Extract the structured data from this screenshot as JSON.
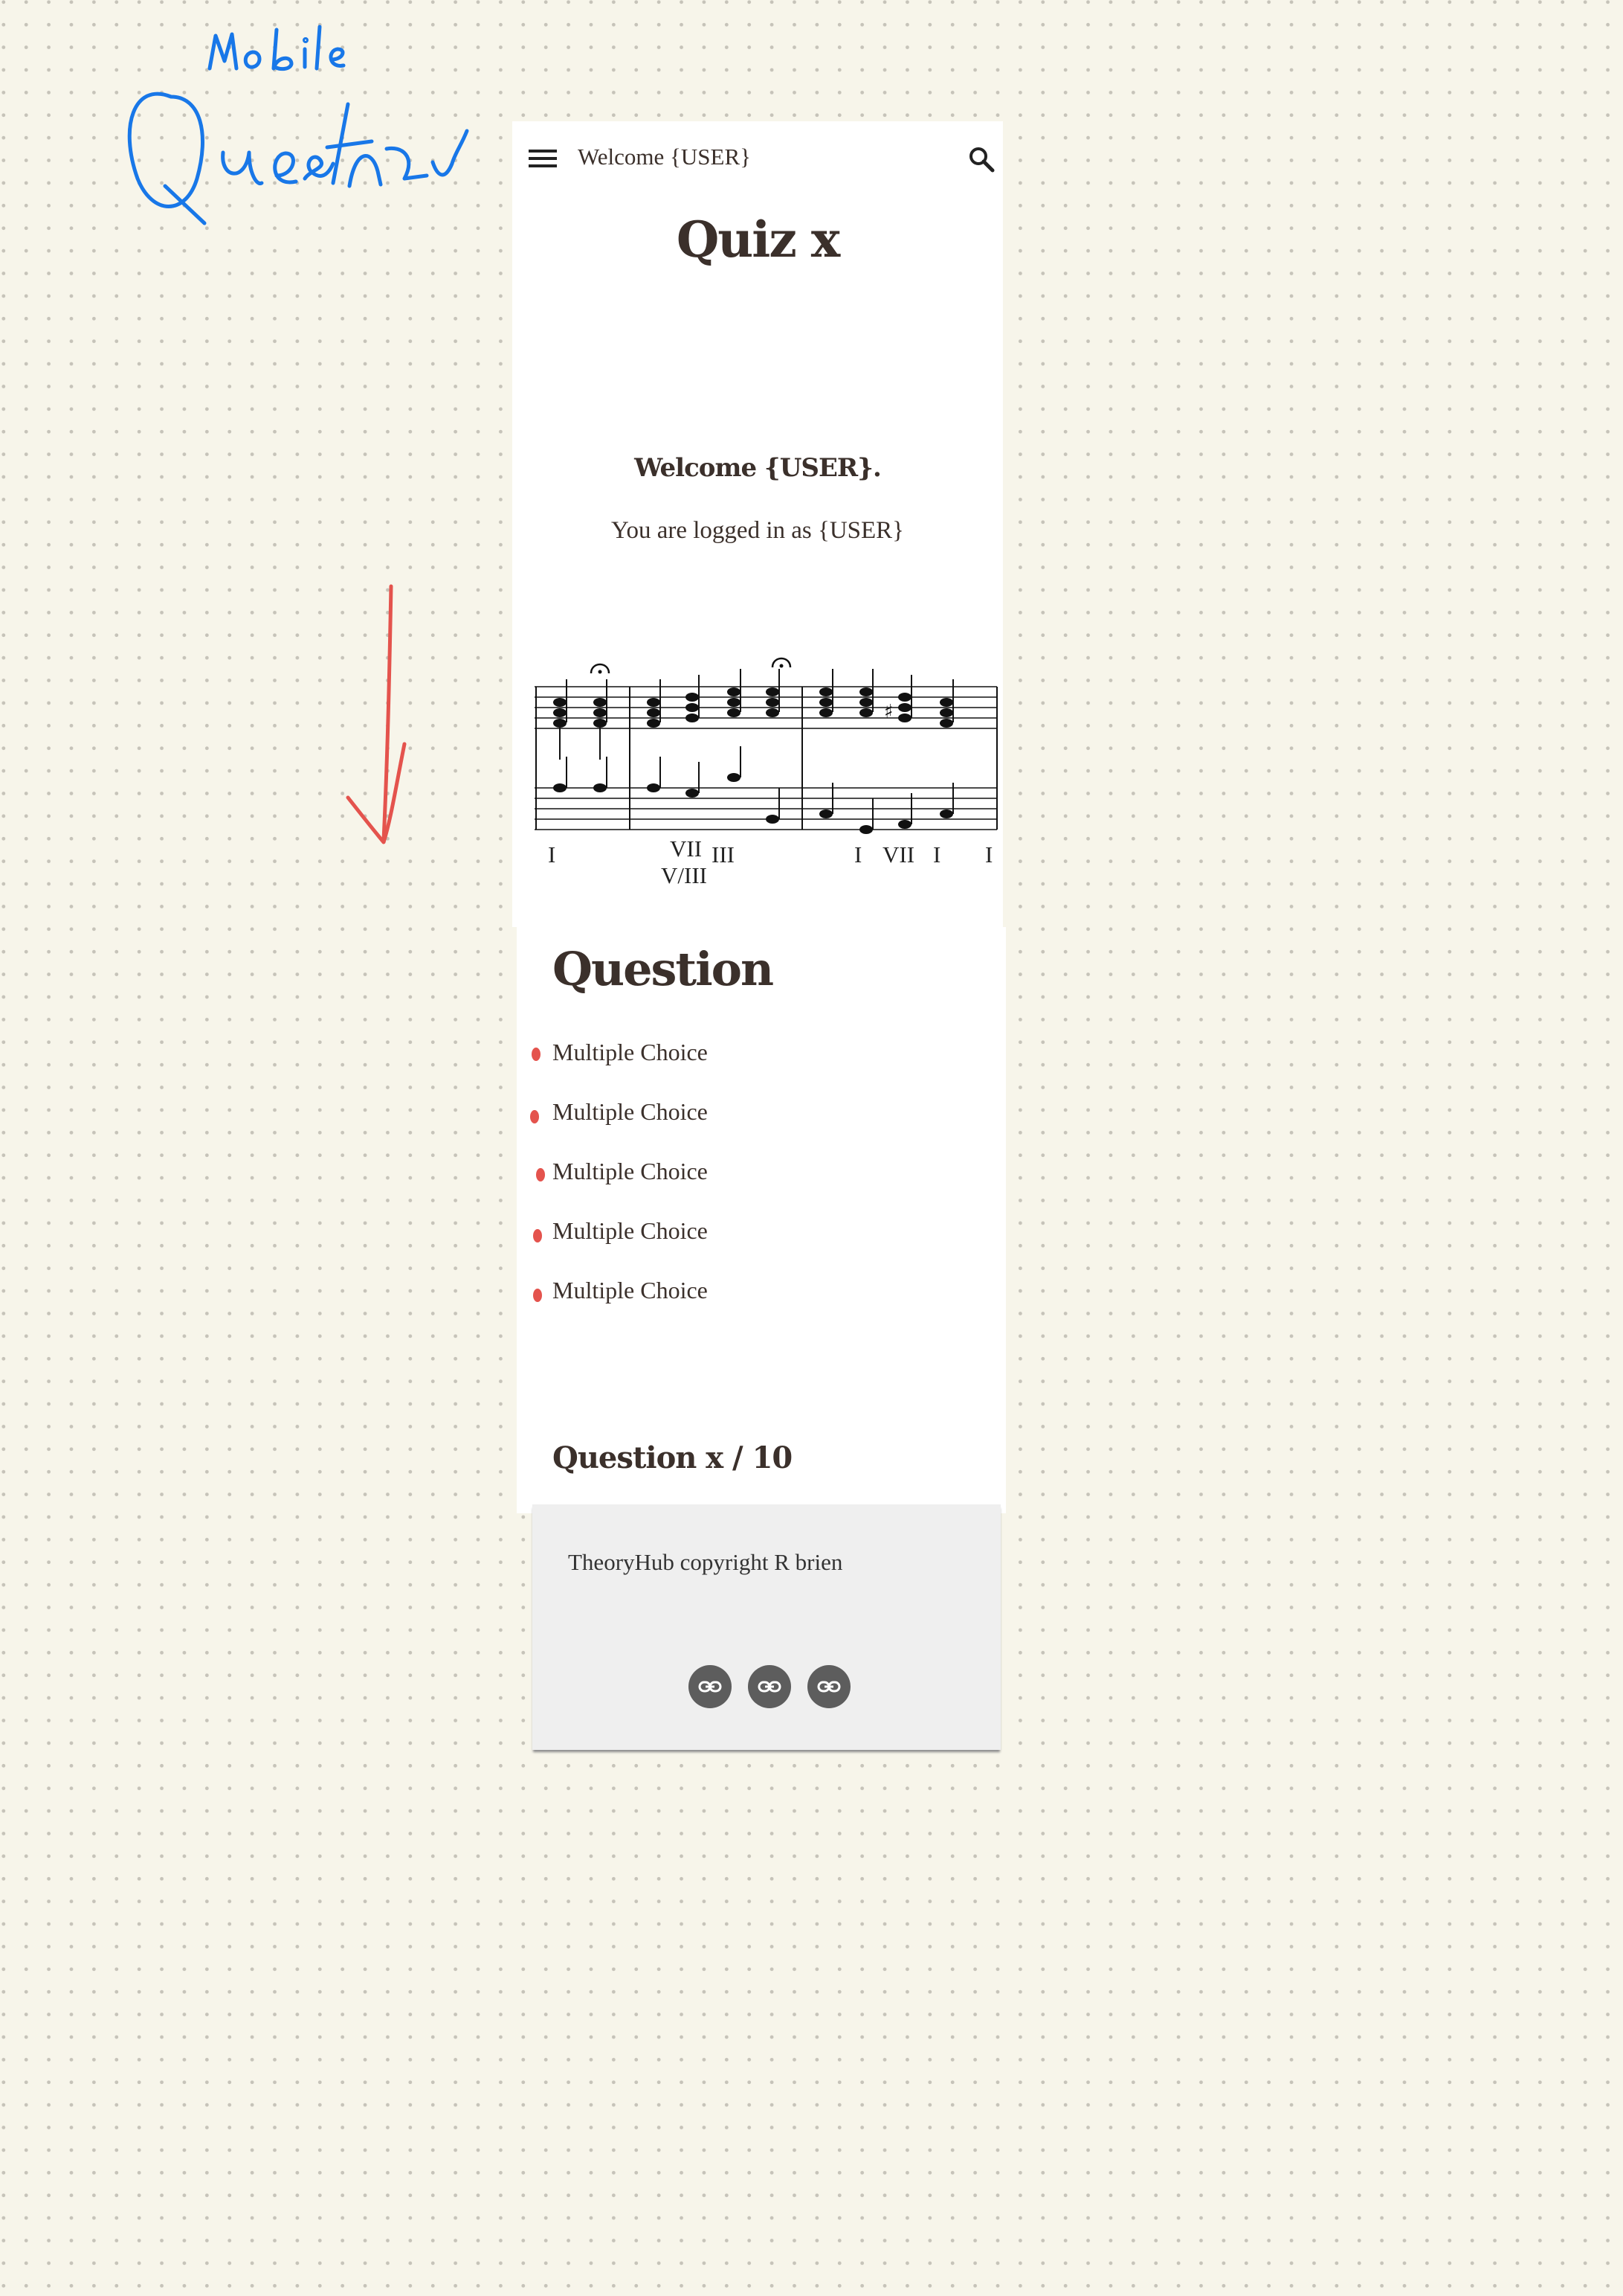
{
  "annotations": {
    "mobile_label": "Mobile",
    "page_label": "Question"
  },
  "colors": {
    "background": "#f7f5ea",
    "text": "#3b302b",
    "radio_marker": "#e4534d",
    "handwriting_blue": "#1877e8",
    "arrow_red": "#e4534d",
    "footer_bg": "#efefef",
    "link_button": "#5d5d5d"
  },
  "appbar": {
    "menu_icon": "hamburger-menu-icon",
    "title": "Welcome {USER}",
    "search_icon": "search-icon"
  },
  "quiz": {
    "title": "Quiz x",
    "welcome": "Welcome {USER}.",
    "logged_in": "You are logged in as {USER}"
  },
  "score": {
    "roman_numerals": [
      "I",
      "VII",
      "III",
      "V/III",
      "I",
      "VII",
      "I",
      "I"
    ]
  },
  "question": {
    "heading": "Question",
    "choices": [
      "Multiple Choice",
      "Multiple Choice",
      "Multiple Choice",
      "Multiple Choice",
      "Multiple Choice"
    ],
    "progress": "Question x / 10"
  },
  "footer": {
    "copyright": "TheoryHub copyright R brien",
    "links": [
      "link-icon",
      "link-icon",
      "link-icon"
    ]
  }
}
